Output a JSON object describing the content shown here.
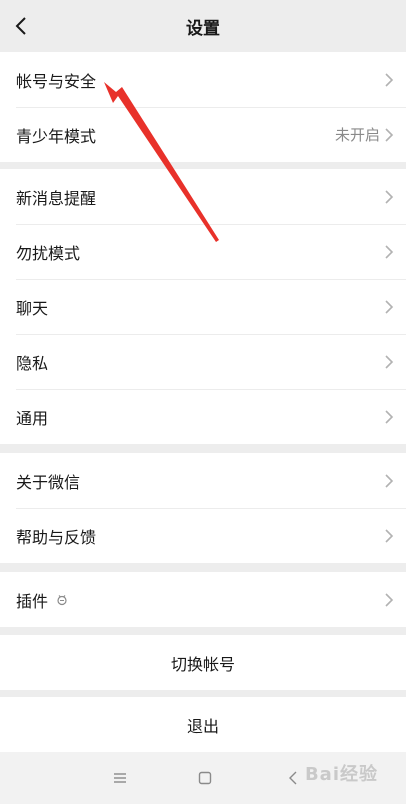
{
  "header": {
    "title": "设置",
    "back_icon": "chevron-left-icon"
  },
  "groups": [
    {
      "items": [
        {
          "label": "帐号与安全",
          "value": ""
        },
        {
          "label": "青少年模式",
          "value": "未开启"
        }
      ]
    },
    {
      "items": [
        {
          "label": "新消息提醒",
          "value": ""
        },
        {
          "label": "勿扰模式",
          "value": ""
        },
        {
          "label": "聊天",
          "value": ""
        },
        {
          "label": "隐私",
          "value": ""
        },
        {
          "label": "通用",
          "value": ""
        }
      ]
    },
    {
      "items": [
        {
          "label": "关于微信",
          "value": ""
        },
        {
          "label": "帮助与反馈",
          "value": ""
        }
      ]
    },
    {
      "items": [
        {
          "label": "插件",
          "value": "",
          "badge_icon": "plugin-badge-icon"
        }
      ]
    }
  ],
  "actions": {
    "switch_account": "切换帐号",
    "logout": "退出"
  },
  "navbar": {
    "menu_icon": "menu-icon",
    "home_icon": "home-square-icon",
    "back_icon": "back-icon"
  },
  "watermark": "Bai经验",
  "annotation": {
    "color": "#e8312a",
    "type": "arrow-pointer"
  },
  "colors": {
    "background": "#ededed",
    "card": "#ffffff",
    "accent_arrow": "#e8312a"
  }
}
